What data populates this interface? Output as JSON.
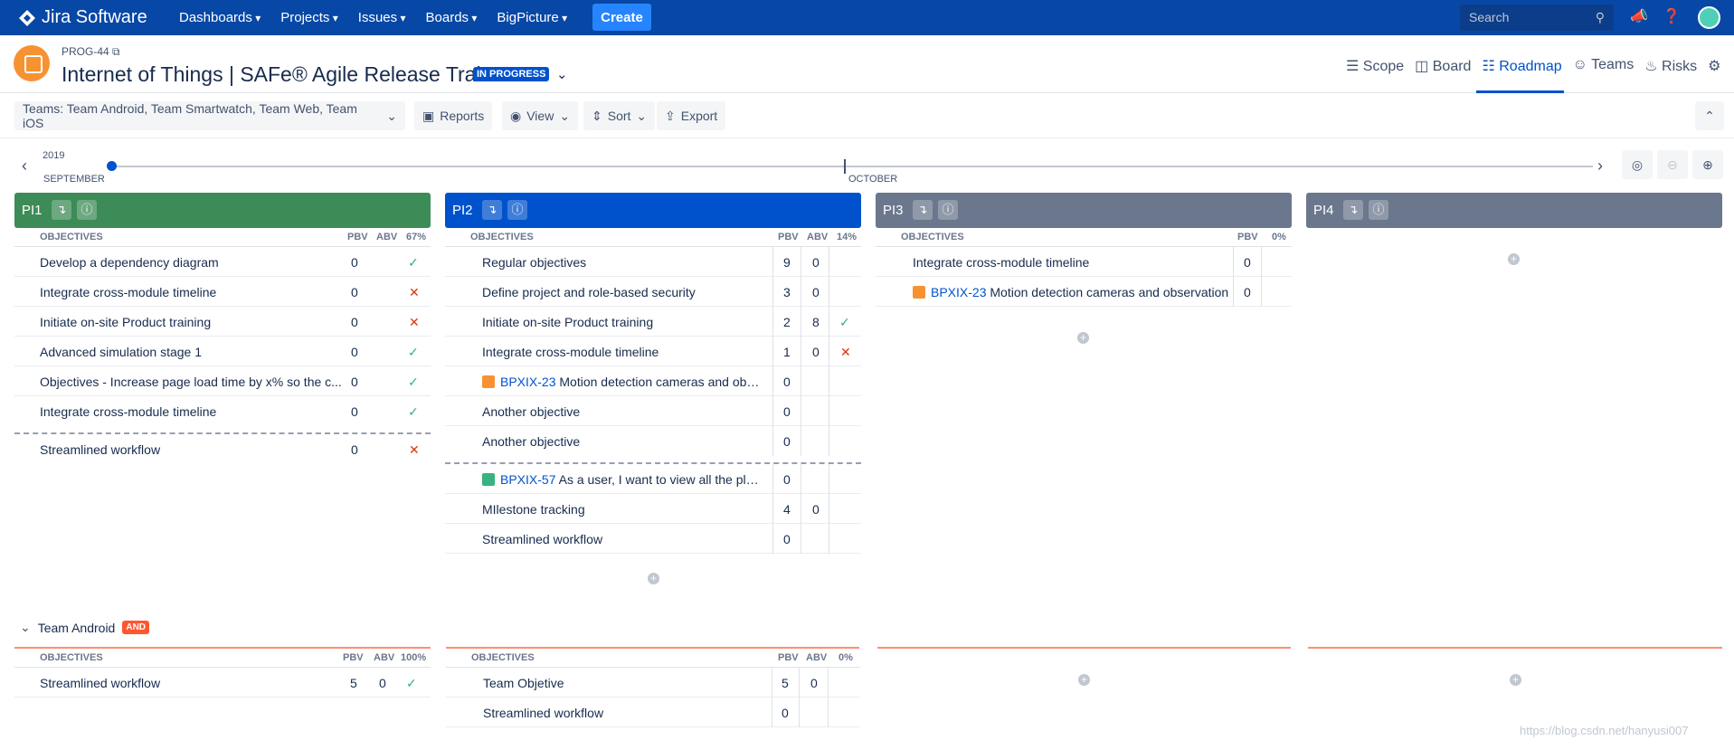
{
  "nav": {
    "logo": "Jira Software",
    "menus": [
      "Dashboards",
      "Projects",
      "Issues",
      "Boards",
      "BigPicture"
    ],
    "create": "Create",
    "search_placeholder": "Search",
    "color": "#0747A6"
  },
  "header": {
    "key": "PROG-44",
    "title": "Internet of Things | SAFe® Agile Release Train",
    "status": "IN PROGRESS",
    "tabs": [
      "Scope",
      "Board",
      "Roadmap",
      "Teams",
      "Risks"
    ],
    "active_tab": "Roadmap"
  },
  "toolbar": {
    "teams": "Teams: Team Android, Team Smartwatch, Team Web, Team iOS",
    "reports": "Reports",
    "view": "View",
    "sort": "Sort",
    "export": "Export"
  },
  "timeline": {
    "year": "2019",
    "month1": "SEPTEMBER",
    "month2": "OCTOBER"
  },
  "pis": [
    {
      "name": "PI1",
      "color": "#3D8B57",
      "header": {
        "obj": "OBJECTIVES",
        "pbv": "PBV",
        "abv": "ABV",
        "pct": "67%"
      },
      "rows": [
        {
          "name": "Develop a dependency diagram",
          "pbv": "0",
          "mark": "check"
        },
        {
          "name": "Integrate cross-module timeline",
          "pbv": "0",
          "mark": "cross"
        },
        {
          "name": "Initiate on-site Product training",
          "pbv": "0",
          "mark": "cross"
        },
        {
          "name": "Advanced simulation stage 1",
          "pbv": "0",
          "mark": "check"
        },
        {
          "name": "Objectives - Increase page load time by x% so the c...",
          "pbv": "0",
          "mark": "check"
        },
        {
          "name": "Integrate cross-module timeline",
          "pbv": "0",
          "mark": "check"
        },
        {
          "name": "Streamlined workflow",
          "pbv": "0",
          "mark": "cross"
        }
      ]
    },
    {
      "name": "PI2",
      "color": "#0052CC",
      "header": {
        "obj": "OBJECTIVES",
        "pbv": "PBV",
        "abv": "ABV",
        "pct": "14%"
      },
      "rows": [
        {
          "name": "Regular objectives",
          "pbv": "9",
          "abv": "0"
        },
        {
          "name": "Define project and role-based security",
          "pbv": "3",
          "abv": "0"
        },
        {
          "name": "Initiate on-site Product training",
          "pbv": "2",
          "abv": "8",
          "mark": "check"
        },
        {
          "name": "Integrate cross-module timeline",
          "pbv": "1",
          "abv": "0",
          "mark": "cross"
        },
        {
          "key": "BPXIX-23",
          "name": "Motion detection cameras and obse...",
          "pbv": "0"
        },
        {
          "name": "Another objective",
          "pbv": "0"
        },
        {
          "name": "Another objective",
          "pbv": "0"
        },
        {
          "key": "BPXIX-57",
          "name": "As a user, I want to view all the plans",
          "pbv": "0"
        },
        {
          "name": "MIlestone tracking",
          "pbv": "4",
          "abv": "0"
        },
        {
          "name": "Streamlined workflow",
          "pbv": "0"
        }
      ]
    },
    {
      "name": "PI3",
      "color": "#6B778C",
      "header": {
        "obj": "OBJECTIVES",
        "pbv": "PBV",
        "pct": "0%"
      },
      "rows": [
        {
          "name": "Integrate cross-module timeline",
          "pbv": "0"
        },
        {
          "key": "BPXIX-23",
          "name": "Motion detection cameras and observation",
          "pbv": "0"
        }
      ]
    },
    {
      "name": "PI4",
      "color": "#6B778C"
    }
  ],
  "team": {
    "name": "Team Android",
    "badge": "AND",
    "pi1": {
      "header": {
        "obj": "OBJECTIVES",
        "pbv": "PBV",
        "abv": "ABV",
        "pct": "100%"
      },
      "rows": [
        {
          "name": "Streamlined workflow",
          "pbv": "5",
          "abv": "0",
          "mark": "check"
        }
      ]
    },
    "pi2": {
      "header": {
        "obj": "OBJECTIVES",
        "pbv": "PBV",
        "abv": "ABV",
        "pct": "0%"
      },
      "rows": [
        {
          "name": "Team Objetive",
          "pbv": "5",
          "abv": "0"
        },
        {
          "name": "Streamlined workflow",
          "pbv": "0"
        }
      ]
    }
  },
  "watermark": "https://blog.csdn.net/hanyusi007"
}
